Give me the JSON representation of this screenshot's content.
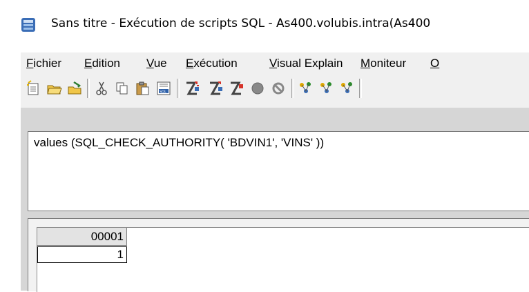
{
  "window": {
    "title": "Sans titre - Exécution de scripts SQL - As400.volubis.intra(As400"
  },
  "menu": [
    {
      "label": "Fichier"
    },
    {
      "label": "Edition"
    },
    {
      "label": "Vue"
    },
    {
      "label": "Exécution"
    },
    {
      "label": "Visual Explain"
    },
    {
      "label": "Moniteur"
    },
    {
      "label": "O"
    }
  ],
  "toolbar": {
    "icons": [
      "new-icon",
      "open-icon",
      "save-icon",
      "cut-icon",
      "copy-icon",
      "paste-icon",
      "insert-sql-icon",
      "run-all-icon",
      "run-from-cursor-icon",
      "run-selected-icon",
      "stop-icon",
      "cancel-icon",
      "explain-icon",
      "explain-run-icon",
      "explain-cursor-icon"
    ]
  },
  "editor": {
    "text": "values (SQL_CHECK_AUTHORITY( 'BDVIN1', 'VINS' ))"
  },
  "results": {
    "columns": [
      "00001"
    ],
    "rows": [
      [
        "1"
      ]
    ]
  }
}
